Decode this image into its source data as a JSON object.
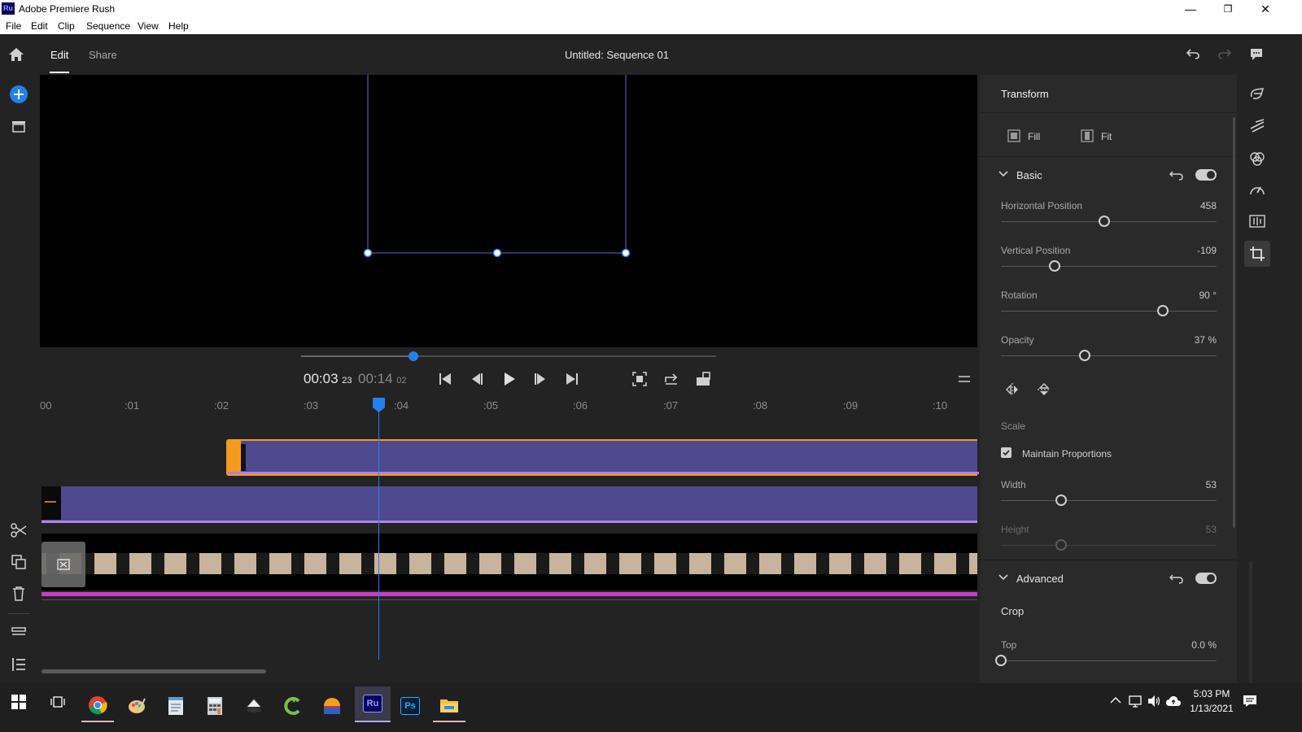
{
  "window": {
    "logo_text": "Ru",
    "title": "Adobe Premiere Rush",
    "minimize": "—",
    "restore": "❐",
    "close": "✕"
  },
  "menu": [
    "File",
    "Edit",
    "Clip",
    "Sequence",
    "View",
    "Help"
  ],
  "topbar": {
    "tabs": [
      "Edit",
      "Share"
    ],
    "active_tab": "Edit",
    "sequence_title": "Untitled: Sequence 01"
  },
  "transport": {
    "current_time": "00:03",
    "current_frames": "23",
    "duration": "00:14",
    "duration_frames": "02",
    "playhead_progress": 0.27
  },
  "ruler": {
    "ticks": [
      "00",
      ":01",
      ":02",
      ":03",
      ":04",
      ":05",
      ":06",
      ":07",
      ":08",
      ":09",
      ":10"
    ]
  },
  "transform": {
    "title": "Transform",
    "fill_label": "Fill",
    "fit_label": "Fit",
    "basic": {
      "label": "Basic",
      "enabled": true,
      "params": [
        {
          "name": "Horizontal Position",
          "value": "458",
          "unit": "",
          "level": 0.48
        },
        {
          "name": "Vertical Position",
          "value": "-109",
          "unit": "",
          "level": 0.25
        },
        {
          "name": "Rotation",
          "value": "90",
          "unit": "°",
          "level": 0.75
        },
        {
          "name": "Opacity",
          "value": "37",
          "unit": "%",
          "level": 0.39
        }
      ]
    },
    "scale": {
      "label": "Scale",
      "maintain_proportions_label": "Maintain Proportions",
      "maintain_proportions": true,
      "params": [
        {
          "name": "Width",
          "value": "53",
          "unit": "",
          "level": 0.28
        },
        {
          "name": "Height",
          "value": "53",
          "unit": "",
          "level": 0.28
        }
      ]
    },
    "advanced": {
      "label": "Advanced",
      "enabled": true,
      "crop_label": "Crop",
      "params": [
        {
          "name": "Top",
          "value": "0.0",
          "unit": "%",
          "level": 0.0
        }
      ]
    }
  },
  "taskbar": {
    "time": "5:03 PM",
    "date": "1/13/2021"
  },
  "colors": {
    "accent_blue": "#2680eb",
    "clip_purple": "#4f4a8f",
    "clip_orange": "#f29b1e",
    "audio_magenta": "#c43fc4"
  }
}
